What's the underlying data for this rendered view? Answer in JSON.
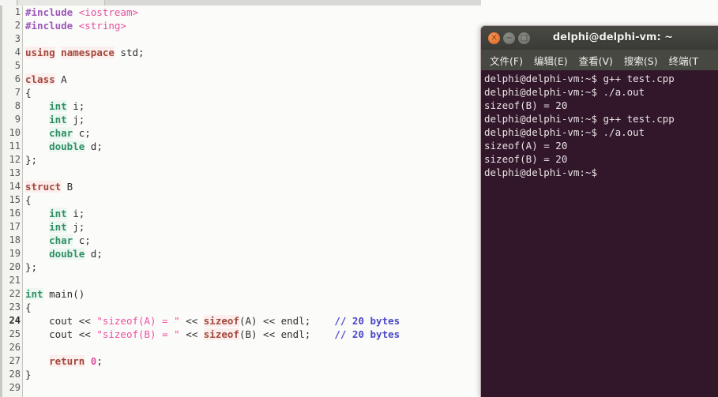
{
  "editor": {
    "tab_strip_present": true,
    "gutter_current_line": 24,
    "lines": [
      {
        "n": "1",
        "tokens": [
          {
            "t": "#include ",
            "c": "k-pre"
          },
          {
            "t": "<iostream>",
            "c": "k-inc"
          }
        ]
      },
      {
        "n": "2",
        "tokens": [
          {
            "t": "#include ",
            "c": "k-pre"
          },
          {
            "t": "<string>",
            "c": "k-inc"
          }
        ]
      },
      {
        "n": "3",
        "tokens": []
      },
      {
        "n": "4",
        "tokens": [
          {
            "t": "using",
            "c": "k-kw"
          },
          {
            "t": " ",
            "c": "k-plain"
          },
          {
            "t": "namespace",
            "c": "k-kw"
          },
          {
            "t": " std;",
            "c": "k-plain"
          }
        ]
      },
      {
        "n": "5",
        "tokens": []
      },
      {
        "n": "6",
        "tokens": [
          {
            "t": "class",
            "c": "k-kw"
          },
          {
            "t": " A",
            "c": "k-plain"
          }
        ]
      },
      {
        "n": "7",
        "tokens": [
          {
            "t": "{",
            "c": "k-plain"
          }
        ]
      },
      {
        "n": "8",
        "tokens": [
          {
            "t": "    ",
            "c": "k-plain"
          },
          {
            "t": "int",
            "c": "k-type"
          },
          {
            "t": " i;",
            "c": "k-plain"
          }
        ]
      },
      {
        "n": "9",
        "tokens": [
          {
            "t": "    ",
            "c": "k-plain"
          },
          {
            "t": "int",
            "c": "k-type"
          },
          {
            "t": " j;",
            "c": "k-plain"
          }
        ]
      },
      {
        "n": "10",
        "tokens": [
          {
            "t": "    ",
            "c": "k-plain"
          },
          {
            "t": "char",
            "c": "k-type"
          },
          {
            "t": " c;",
            "c": "k-plain"
          }
        ]
      },
      {
        "n": "11",
        "tokens": [
          {
            "t": "    ",
            "c": "k-plain"
          },
          {
            "t": "double",
            "c": "k-type"
          },
          {
            "t": " d;",
            "c": "k-plain"
          }
        ]
      },
      {
        "n": "12",
        "tokens": [
          {
            "t": "};",
            "c": "k-plain"
          }
        ]
      },
      {
        "n": "13",
        "tokens": []
      },
      {
        "n": "14",
        "tokens": [
          {
            "t": "struct",
            "c": "k-kw"
          },
          {
            "t": " B",
            "c": "k-plain"
          }
        ]
      },
      {
        "n": "15",
        "tokens": [
          {
            "t": "{",
            "c": "k-plain"
          }
        ]
      },
      {
        "n": "16",
        "tokens": [
          {
            "t": "    ",
            "c": "k-plain"
          },
          {
            "t": "int",
            "c": "k-type"
          },
          {
            "t": " i;",
            "c": "k-plain"
          }
        ]
      },
      {
        "n": "17",
        "tokens": [
          {
            "t": "    ",
            "c": "k-plain"
          },
          {
            "t": "int",
            "c": "k-type"
          },
          {
            "t": " j;",
            "c": "k-plain"
          }
        ]
      },
      {
        "n": "18",
        "tokens": [
          {
            "t": "    ",
            "c": "k-plain"
          },
          {
            "t": "char",
            "c": "k-type"
          },
          {
            "t": " c;",
            "c": "k-plain"
          }
        ]
      },
      {
        "n": "19",
        "tokens": [
          {
            "t": "    ",
            "c": "k-plain"
          },
          {
            "t": "double",
            "c": "k-type"
          },
          {
            "t": " d;",
            "c": "k-plain"
          }
        ]
      },
      {
        "n": "20",
        "tokens": [
          {
            "t": "};",
            "c": "k-plain"
          }
        ]
      },
      {
        "n": "21",
        "tokens": []
      },
      {
        "n": "22",
        "tokens": [
          {
            "t": "int",
            "c": "k-type"
          },
          {
            "t": " main()",
            "c": "k-plain"
          }
        ]
      },
      {
        "n": "23",
        "tokens": [
          {
            "t": "{",
            "c": "k-plain"
          }
        ]
      },
      {
        "n": "24",
        "current": true,
        "tokens": [
          {
            "t": "    cout << ",
            "c": "k-plain"
          },
          {
            "t": "\"sizeof(A) = \"",
            "c": "k-str"
          },
          {
            "t": " << ",
            "c": "k-plain"
          },
          {
            "t": "sizeof",
            "c": "k-fn"
          },
          {
            "t": "(A) << endl;",
            "c": "k-plain"
          },
          {
            "t": "    ",
            "c": "k-plain"
          },
          {
            "t": "// 20 bytes",
            "c": "k-cmt"
          }
        ]
      },
      {
        "n": "25",
        "tokens": [
          {
            "t": "    cout << ",
            "c": "k-plain"
          },
          {
            "t": "\"sizeof(B) = \"",
            "c": "k-str"
          },
          {
            "t": " << ",
            "c": "k-plain"
          },
          {
            "t": "sizeof",
            "c": "k-fn"
          },
          {
            "t": "(B) << endl;",
            "c": "k-plain"
          },
          {
            "t": "    ",
            "c": "k-plain"
          },
          {
            "t": "// 20 bytes",
            "c": "k-cmt"
          }
        ]
      },
      {
        "n": "26",
        "tokens": []
      },
      {
        "n": "27",
        "tokens": [
          {
            "t": "    ",
            "c": "k-plain"
          },
          {
            "t": "return",
            "c": "k-kw"
          },
          {
            "t": " ",
            "c": "k-plain"
          },
          {
            "t": "0",
            "c": "k-num"
          },
          {
            "t": ";",
            "c": "k-plain"
          }
        ]
      },
      {
        "n": "28",
        "tokens": [
          {
            "t": "}",
            "c": "k-plain"
          }
        ]
      },
      {
        "n": "29",
        "tokens": []
      }
    ]
  },
  "terminal": {
    "title": "delphi@delphi-vm: ~",
    "window_buttons": [
      {
        "name": "close-button",
        "glyph": "✕",
        "color": "#dd5f1b"
      },
      {
        "name": "minimize-button",
        "glyph": "−",
        "color": "#7d7d77"
      },
      {
        "name": "maximize-button",
        "glyph": "□",
        "color": "#7d7d77"
      }
    ],
    "menu": [
      "文件(F)",
      "编辑(E)",
      "查看(V)",
      "搜索(S)",
      "终端(T"
    ],
    "background_color": "#32172a",
    "text_color": "#e8e2e4",
    "lines": [
      "delphi@delphi-vm:~$ g++ test.cpp",
      "delphi@delphi-vm:~$ ./a.out",
      "sizeof(B) = 20",
      "delphi@delphi-vm:~$ g++ test.cpp",
      "delphi@delphi-vm:~$ ./a.out",
      "sizeof(A) = 20",
      "sizeof(B) = 20",
      "delphi@delphi-vm:~$"
    ]
  }
}
